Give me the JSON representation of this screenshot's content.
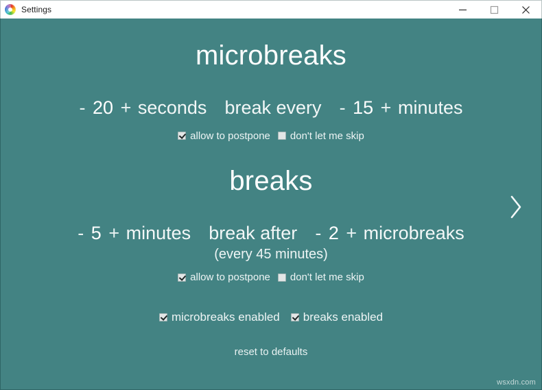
{
  "window": {
    "title": "Settings",
    "app_icon": "rainbow-spiral-icon",
    "controls": {
      "minimize": "minimize-icon",
      "maximize": "maximize-icon",
      "close": "close-icon"
    },
    "background_color": "#438383",
    "text_color": "#eef5f5"
  },
  "microbreaks": {
    "title": "microbreaks",
    "duration": {
      "decrement": "-",
      "value": "20",
      "increment": "+",
      "unit": "seconds"
    },
    "middle_text": "break every",
    "interval": {
      "decrement": "-",
      "value": "15",
      "increment": "+",
      "unit": "minutes"
    },
    "options": [
      {
        "label": "allow to postpone",
        "checked": true
      },
      {
        "label": "don't let me skip",
        "checked": false
      }
    ]
  },
  "breaks": {
    "title": "breaks",
    "next_arrow": "chevron-right-icon",
    "duration": {
      "decrement": "-",
      "value": "5",
      "increment": "+",
      "unit": "minutes"
    },
    "middle_text": "break after",
    "count": {
      "decrement": "-",
      "value": "2",
      "increment": "+",
      "unit": "microbreaks"
    },
    "note": "(every 45 minutes)",
    "options": [
      {
        "label": "allow to postpone",
        "checked": true
      },
      {
        "label": "don't let me skip",
        "checked": false
      }
    ]
  },
  "footer": {
    "toggles": [
      {
        "label": "microbreaks enabled",
        "checked": true
      },
      {
        "label": "breaks enabled",
        "checked": true
      }
    ],
    "reset_label": "reset to defaults"
  },
  "watermark": "wsxdn.com"
}
